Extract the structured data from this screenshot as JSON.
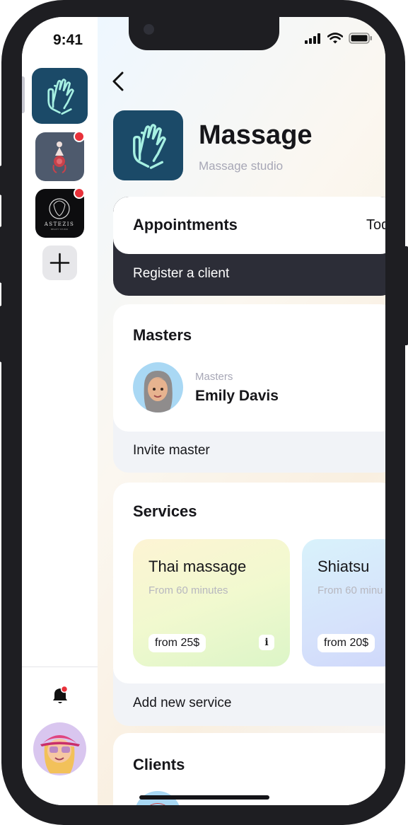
{
  "status_bar": {
    "time": "9:41"
  },
  "header": {
    "title": "Massage",
    "subtitle": "Massage studio"
  },
  "appointments": {
    "title": "Appointments",
    "today_tab": "Tod",
    "register_action": "Register a client"
  },
  "masters": {
    "title": "Masters",
    "items": [
      {
        "role": "Masters",
        "name": "Emily Davis"
      }
    ],
    "invite_action": "Invite master"
  },
  "services": {
    "title": "Services",
    "items": [
      {
        "name": "Thai massage",
        "duration": "From 60 minutes",
        "price": "from 25$",
        "info": "i"
      },
      {
        "name": "Shiatsu",
        "duration": "From 60 minu",
        "price": "from 20$"
      }
    ],
    "add_action": "Add new service"
  },
  "clients": {
    "title": "Clients"
  },
  "sidebar": {
    "apps": [
      {
        "name": "Massage",
        "selected": true
      },
      {
        "name": "Rose salon",
        "notification": true
      },
      {
        "name": "Astezis",
        "logo_text": "ASTEZIS",
        "notification": true
      }
    ]
  },
  "colors": {
    "brand": "#1b4a68",
    "brand_icon": "#a6f0e2",
    "dark_bar": "#2c2d37",
    "notification": "#e8313a"
  }
}
